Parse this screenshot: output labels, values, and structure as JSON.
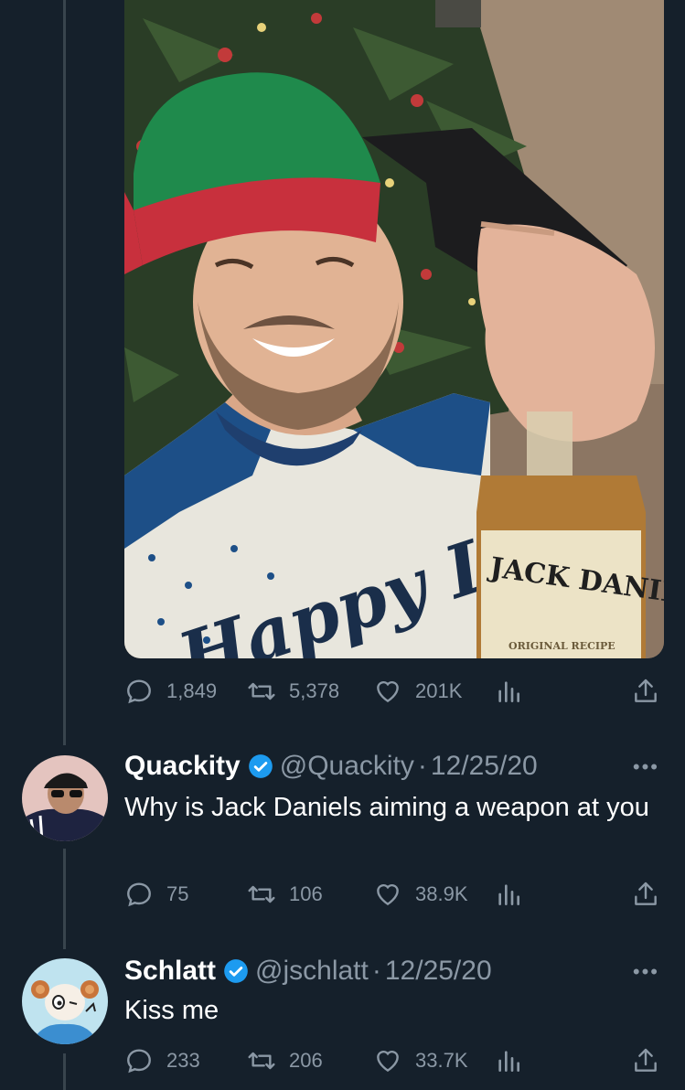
{
  "colors": {
    "background": "#15202b",
    "muted": "#8b98a5",
    "verified": "#1d9bf0",
    "line": "#38444d"
  },
  "photo": {
    "sweater_text": "Happy Litt",
    "bottle_label": "JACK DANIEL'S",
    "bottle_sub": "ORIGINAL RECIPE"
  },
  "main_tweet": {
    "replies": "1,849",
    "retweets": "5,378",
    "likes": "201K"
  },
  "replies": [
    {
      "name": "Quackity",
      "handle": "@Quackity",
      "date": "12/25/20",
      "text": "Why is Jack Daniels aiming a weapon at you",
      "replies": "75",
      "retweets": "106",
      "likes": "38.9K"
    },
    {
      "name": "Schlatt",
      "handle": "@jschlatt",
      "date": "12/25/20",
      "text": "Kiss me",
      "replies": "233",
      "retweets": "206",
      "likes": "33.7K"
    }
  ],
  "separator": "·",
  "more_label": "•••",
  "icons": [
    "reply-icon",
    "retweet-icon",
    "like-icon",
    "analytics-icon",
    "share-icon",
    "verified-icon",
    "more-icon"
  ]
}
